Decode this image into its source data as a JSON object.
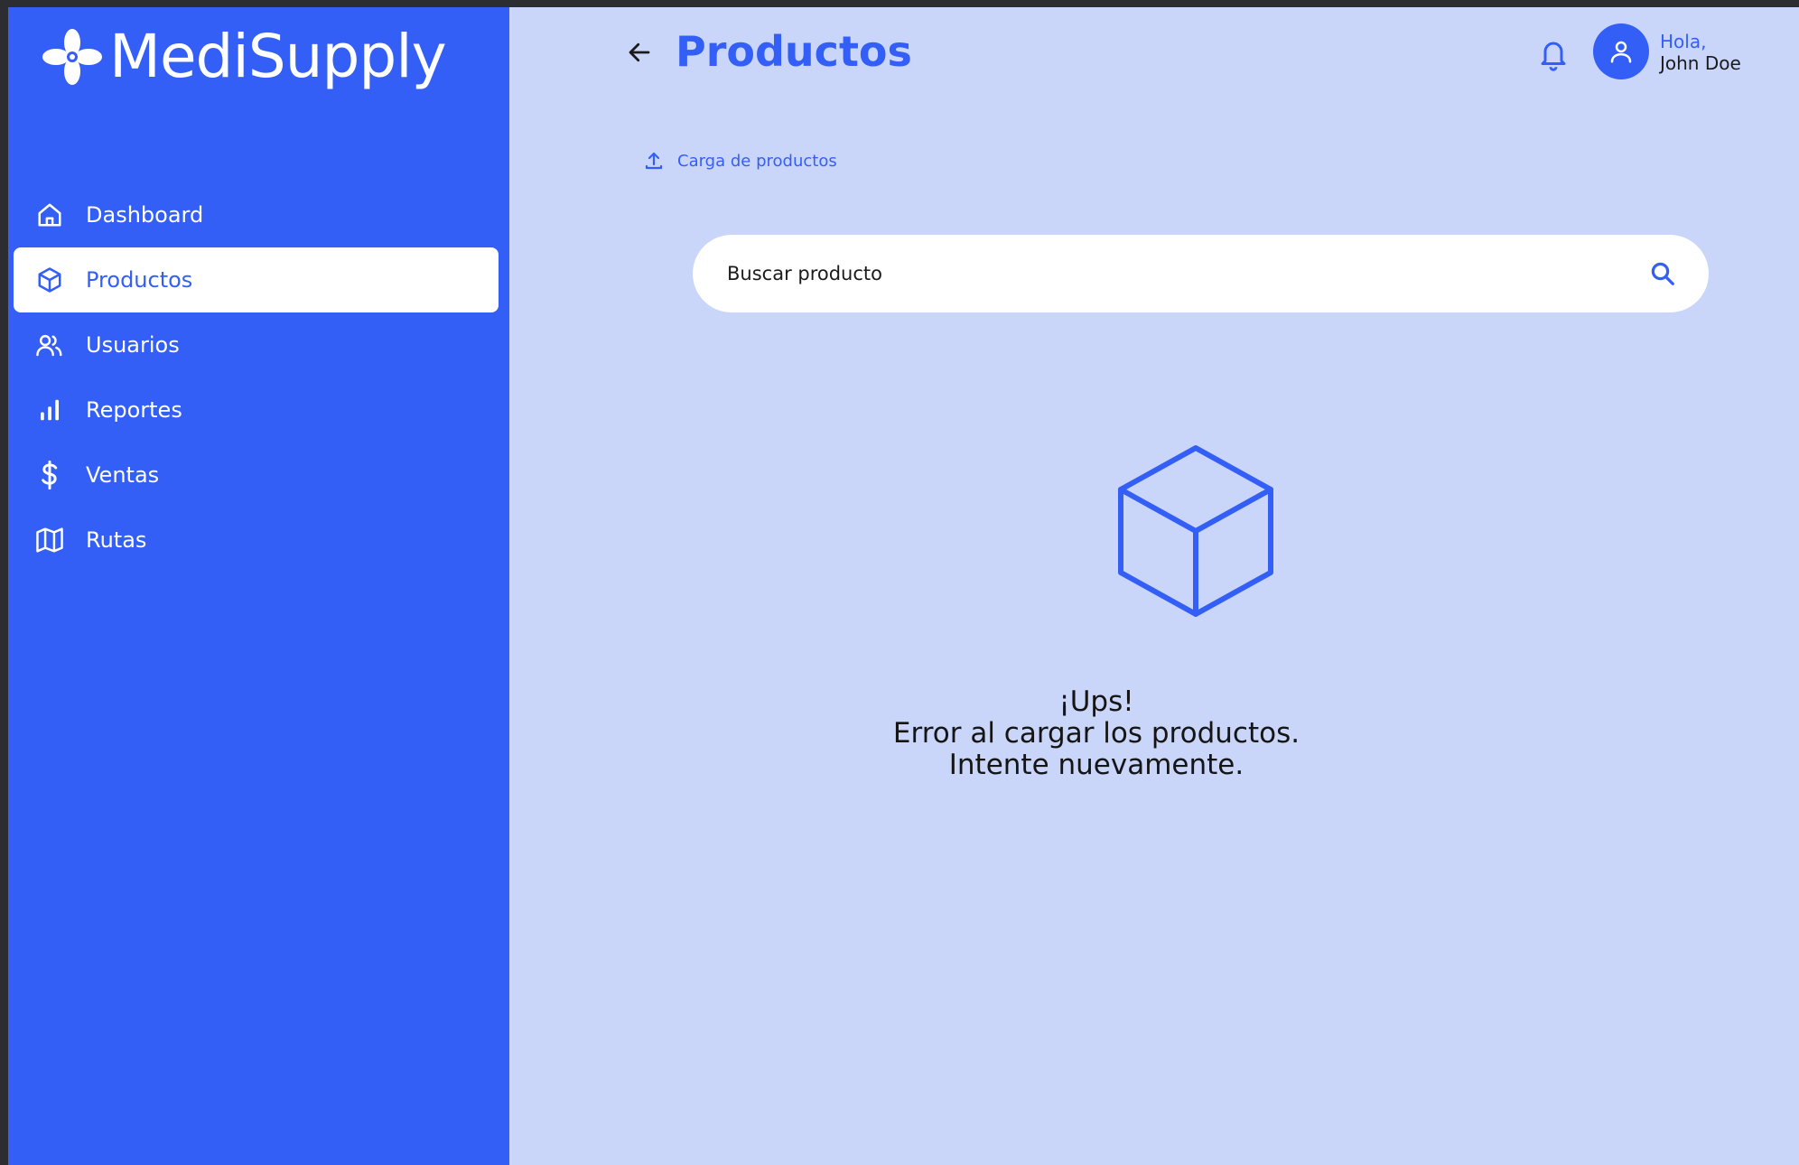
{
  "app": {
    "brand": "MediSupply"
  },
  "sidebar": {
    "items": [
      {
        "label": "Dashboard",
        "icon": "home-icon"
      },
      {
        "label": "Productos",
        "icon": "cube-icon",
        "active": true
      },
      {
        "label": "Usuarios",
        "icon": "users-icon"
      },
      {
        "label": "Reportes",
        "icon": "bar-chart-icon"
      },
      {
        "label": "Ventas",
        "icon": "dollar-icon"
      },
      {
        "label": "Rutas",
        "icon": "map-icon"
      }
    ]
  },
  "header": {
    "title": "Productos",
    "greeting": "Hola,",
    "user_name": "John Doe"
  },
  "actions": {
    "upload_label": "Carga de productos"
  },
  "search": {
    "placeholder": "Buscar producto",
    "value": ""
  },
  "empty_state": {
    "icon": "cube-icon",
    "line1": "¡Ups!",
    "line2": "Error al cargar los productos.",
    "line3": "Intente nuevamente."
  },
  "colors": {
    "primary": "#345ff7",
    "background": "#cad6f9",
    "text": "#151515"
  }
}
